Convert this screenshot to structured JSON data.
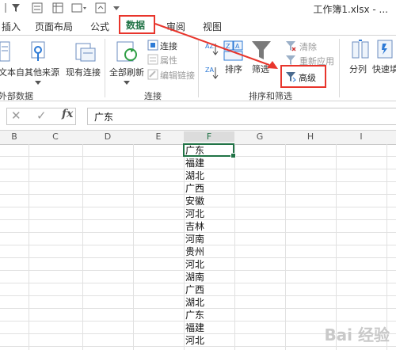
{
  "title": "工作簿1.xlsx - ...",
  "tabs": [
    "插入",
    "页面布局",
    "公式",
    "数据",
    "审阅",
    "视图"
  ],
  "ribbon": {
    "external": {
      "from_text": "文本",
      "other_sources": "自其他来源",
      "existing": "现有连接",
      "group": "外部数据"
    },
    "connections": {
      "refresh_all": "全部刷新",
      "connections": "连接",
      "properties": "属性",
      "edit_links": "编辑链接",
      "group": "连接"
    },
    "sort": {
      "sort": "排序",
      "filter": "筛选",
      "clear": "清除",
      "reapply": "重新应用",
      "advanced": "高级",
      "group": "排序和筛选"
    },
    "tools": {
      "text_to_columns": "分列",
      "flash_fill": "快速填"
    }
  },
  "formula_bar": {
    "fx": "fx",
    "value": "广东"
  },
  "columns": [
    "B",
    "C",
    "D",
    "E",
    "F",
    "G",
    "H",
    "I"
  ],
  "cells": [
    "广东",
    "福建",
    "湖北",
    "广西",
    "安徽",
    "河北",
    "吉林",
    "河南",
    "贵州",
    "河北",
    "湖南",
    "广西",
    "湖北",
    "广东",
    "福建",
    "河北"
  ],
  "watermark": "Bai 经验",
  "colors": {
    "selection": "#217346",
    "highlight": "#e8352c",
    "tab_active": "#217346"
  }
}
